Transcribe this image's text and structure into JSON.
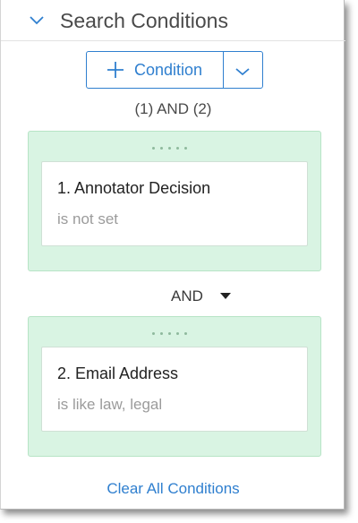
{
  "header": {
    "title": "Search Conditions",
    "collapse_icon": "chevron-down-icon"
  },
  "toolbar": {
    "add_label": "Condition",
    "add_icon": "plus-icon",
    "dropdown_icon": "chevron-down-icon"
  },
  "expression": "(1) AND (2)",
  "groups": [
    {
      "name": "1. Annotator Decision",
      "condition": "is not set"
    },
    {
      "name": "2. Email Address",
      "condition": "is like law, legal"
    }
  ],
  "operator": {
    "label": "AND",
    "icon": "caret-down-icon"
  },
  "clear_label": "Clear All Conditions",
  "colors": {
    "accent": "#2f7fcf",
    "group_bg": "#d9f4e3",
    "group_border": "#b7e4c6",
    "muted_text": "#9b9b9b"
  }
}
